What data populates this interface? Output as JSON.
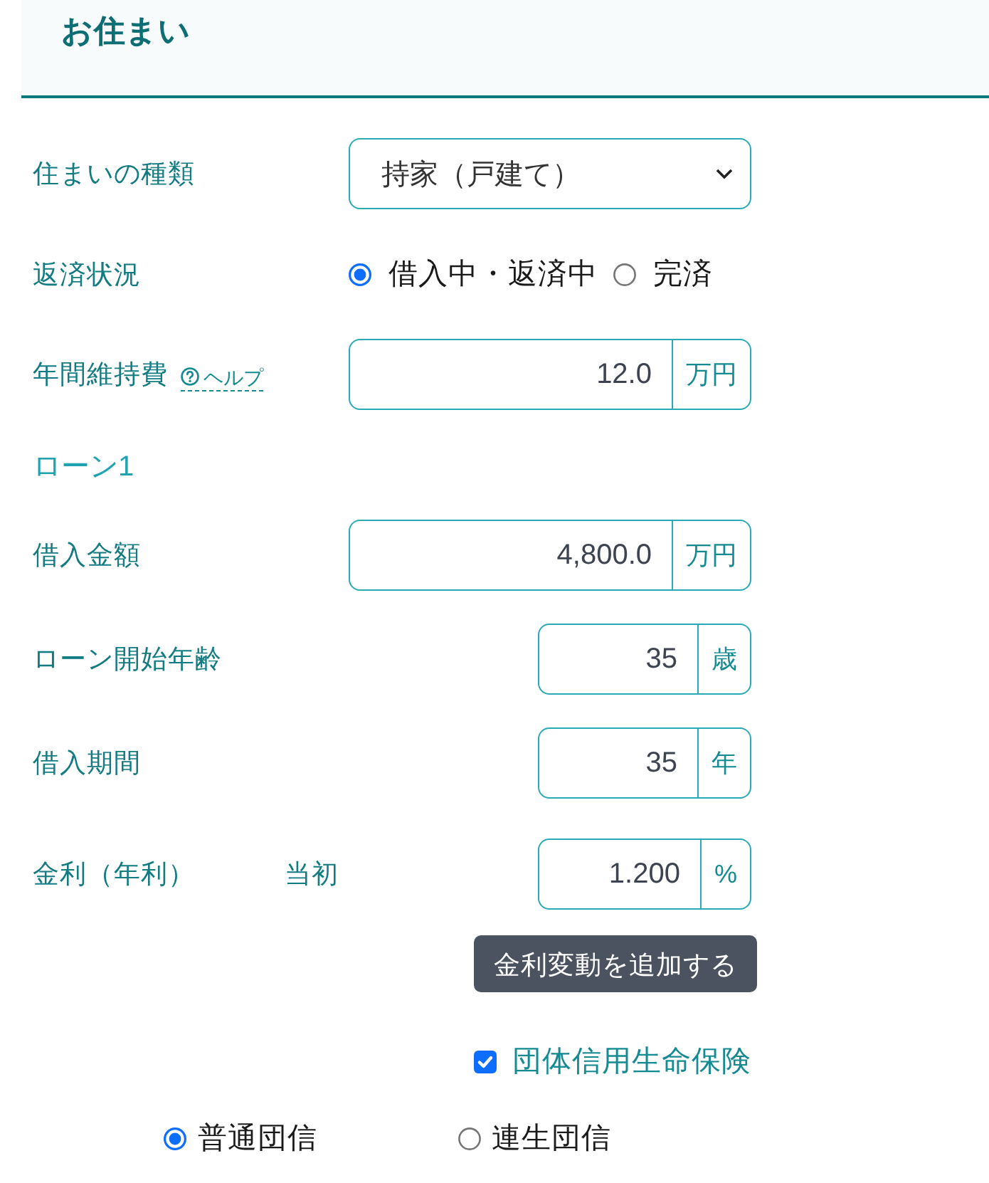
{
  "section": {
    "title": "お住まい"
  },
  "housing": [
    {
      "kind": "select",
      "label": "住まいの種類",
      "value": "持家（戸建て）"
    },
    {
      "kind": "radio",
      "label": "返済状況",
      "options": [
        {
          "label": "借入中・返済中",
          "selected": true
        },
        {
          "label": "完済",
          "selected": false
        }
      ]
    },
    {
      "kind": "wide",
      "label": "年間維持費",
      "help": "ヘルプ",
      "value": "12.0",
      "unit": "万円"
    }
  ],
  "loan": {
    "title": "ローン1",
    "fields": [
      {
        "kind": "wide",
        "label": "借入金額",
        "value": "4,800.0",
        "unit": "万円"
      },
      {
        "kind": "narrow",
        "label": "ローン開始年齢",
        "value": "35",
        "unit": "歳"
      },
      {
        "kind": "narrow",
        "label": "借入期間",
        "value": "35",
        "unit": "年"
      },
      {
        "kind": "narrow",
        "label": "金利（年利）",
        "sublabel": "当初",
        "value": "1.200",
        "unit": "%"
      }
    ],
    "add_button": "金利変動を追加する",
    "insurance": {
      "label": "団体信用生命保険",
      "checked": true
    },
    "insurance_types": [
      {
        "label": "普通団信",
        "selected": true
      },
      {
        "label": "連生団信",
        "selected": false
      }
    ]
  }
}
